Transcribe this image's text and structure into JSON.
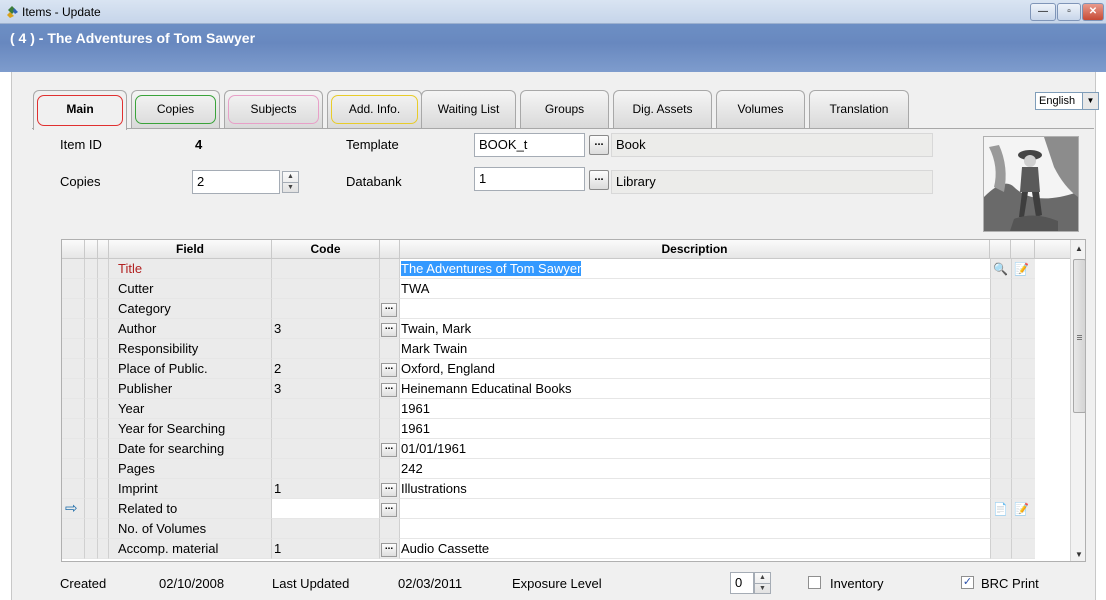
{
  "window": {
    "title": "Items - Update",
    "controls": {
      "minimize": "—",
      "maximize": "▫",
      "close": "✕"
    }
  },
  "header": {
    "record_title": "( 4 ) - The Adventures of Tom Sawyer"
  },
  "tabs": [
    {
      "label": "Main",
      "active": true,
      "ring_color": "#e03030"
    },
    {
      "label": "Copies",
      "ring_color": "#3aa33a"
    },
    {
      "label": "Subjects",
      "ring_color": "#e8a0c8"
    },
    {
      "label": "Add. Info.",
      "ring_color": "#e8cc2a"
    },
    {
      "label": "Waiting List"
    },
    {
      "label": "Groups"
    },
    {
      "label": "Dig. Assets"
    },
    {
      "label": "Volumes"
    },
    {
      "label": "Translation"
    }
  ],
  "language": {
    "value": "English"
  },
  "form": {
    "item_id_label": "Item ID",
    "item_id": "4",
    "copies_label": "Copies",
    "copies": "2",
    "template_label": "Template",
    "template_code": "BOOK_t",
    "template_name": "Book",
    "databank_label": "Databank",
    "databank_code": "1",
    "databank_name": "Library",
    "ellipsis": "..."
  },
  "grid": {
    "headers": {
      "field": "Field",
      "code": "Code",
      "description": "Description"
    },
    "rows": [
      {
        "field": "Title",
        "code": "",
        "has_button": false,
        "description": "The Adventures of Tom Sawyer",
        "selected": true,
        "icons": [
          "search-edit-icon",
          "note-icon"
        ]
      },
      {
        "field": "Cutter",
        "code": "",
        "has_button": false,
        "description": "TWA"
      },
      {
        "field": "Category",
        "code": "",
        "has_button": true,
        "description": ""
      },
      {
        "field": "Author",
        "code": "3",
        "has_button": true,
        "description": "Twain, Mark"
      },
      {
        "field": "Responsibility",
        "code": "",
        "has_button": false,
        "description": "Mark Twain"
      },
      {
        "field": "Place of Public.",
        "code": "2",
        "has_button": true,
        "description": "Oxford, England"
      },
      {
        "field": "Publisher",
        "code": "3",
        "has_button": true,
        "description": "Heinemann Educatinal Books"
      },
      {
        "field": "Year",
        "code": "",
        "has_button": false,
        "description": "1961"
      },
      {
        "field": "Year for Searching",
        "code": "",
        "has_button": false,
        "description": "1961"
      },
      {
        "field": "Date for searching",
        "code": "",
        "has_button": true,
        "description": "01/01/1961"
      },
      {
        "field": "Pages",
        "code": "",
        "has_button": false,
        "description": "242"
      },
      {
        "field": "Imprint",
        "code": "1",
        "has_button": true,
        "description": "Illustrations"
      },
      {
        "field": "Related to",
        "code": "",
        "has_button": true,
        "description": "",
        "current": true,
        "editable": true,
        "icons": [
          "add-record-icon",
          "note-icon"
        ]
      },
      {
        "field": "No. of Volumes",
        "code": "",
        "has_button": false,
        "description": ""
      },
      {
        "field": "Accomp. material",
        "code": "1",
        "has_button": true,
        "description": "Audio Cassette"
      }
    ]
  },
  "footer": {
    "created_label": "Created",
    "created": "02/10/2008",
    "updated_label": "Last Updated",
    "updated": "02/03/2011",
    "exposure_label": "Exposure Level",
    "exposure": "0",
    "inventory_label": "Inventory",
    "inventory_checked": false,
    "brc_label": "BRC Print",
    "brc_checked": true
  }
}
